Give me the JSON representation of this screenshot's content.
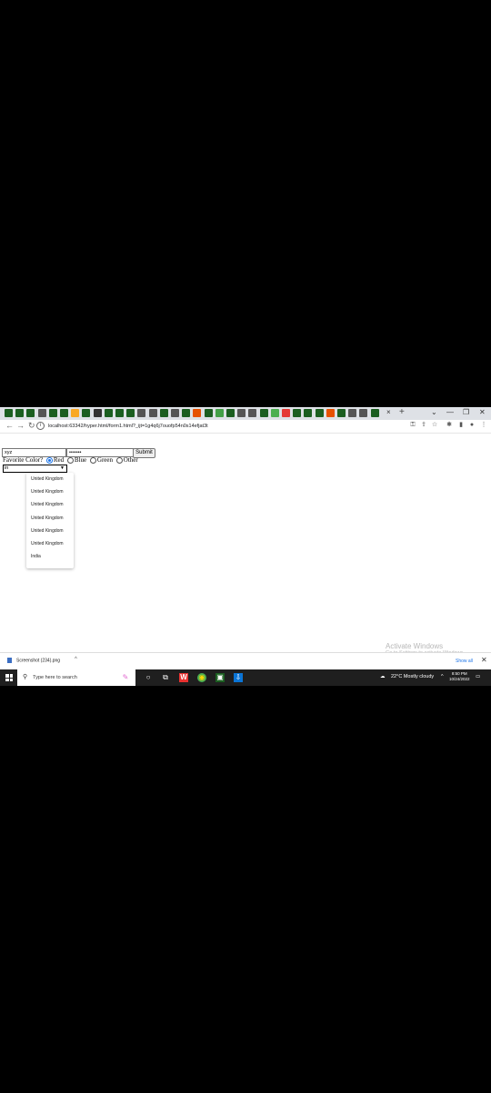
{
  "browser": {
    "url": "localhost:63342/hyper.html/form1.html?_ijt=1g4q6j7ouofp54n0s14efjat3t",
    "new_tab_label": "+",
    "tab_close": "×",
    "window_controls": {
      "chevron": "⌄",
      "minimize": "—",
      "restore": "❐",
      "close": "✕"
    }
  },
  "form": {
    "username_value": "xyz",
    "password_value": "•••••••",
    "submit_label": "Submit",
    "favorite_color_label": "Favorite Color?",
    "colors": [
      {
        "label": "Red",
        "checked": true
      },
      {
        "label": "Blue",
        "checked": false
      },
      {
        "label": "Green",
        "checked": false
      },
      {
        "label": "Other",
        "checked": false
      }
    ],
    "select_value": "in",
    "dropdown_options": [
      "United Kingdom",
      "United Kingdom",
      "United Kingdom",
      "United Kingdom",
      "United Kingdom",
      "United Kingdom",
      "India"
    ]
  },
  "watermark": {
    "title": "Activate Windows",
    "subtitle": "Go to Settings to activate Windows."
  },
  "download_bar": {
    "file_name": "Screenshot (234).png",
    "show_all": "Show all",
    "close": "✕"
  },
  "taskbar": {
    "search_placeholder": "Type here to search",
    "weather": "22°C  Mostly cloudy",
    "time": "8:50 PM",
    "date": "10/24/2022"
  }
}
